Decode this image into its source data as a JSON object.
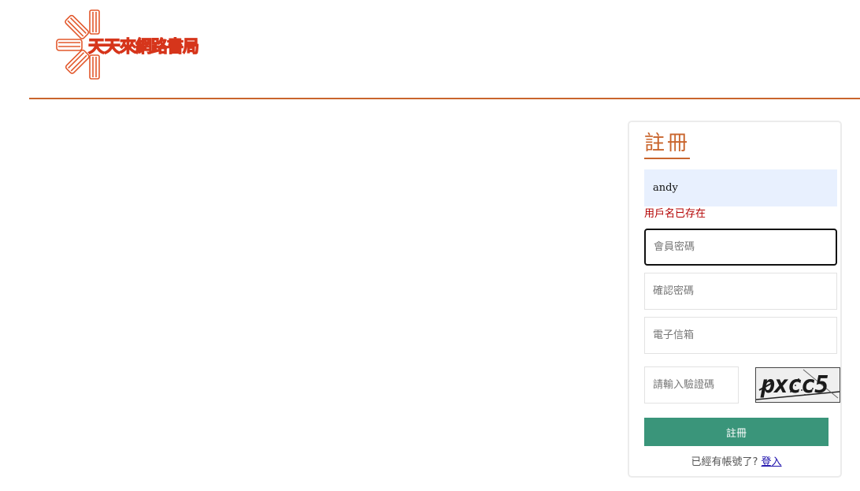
{
  "header": {
    "logo_text": "天天來網路書局",
    "logo_icon": "book-sunburst-icon"
  },
  "register": {
    "title": "註冊",
    "username_value": "andy",
    "username_error": "用戶名已存在",
    "password_placeholder": "會員密碼",
    "confirm_placeholder": "確認密碼",
    "email_placeholder": "電子信箱",
    "captcha_placeholder": "請輸入驗證碼",
    "captcha_code": "pxcc5",
    "submit_label": "註冊",
    "login_prompt": "已經有帳號了?",
    "login_link": "登入"
  },
  "colors": {
    "accent": "#c9652d",
    "button": "#3a957a",
    "error": "#b30000",
    "autofill": "#e8f0fe"
  }
}
